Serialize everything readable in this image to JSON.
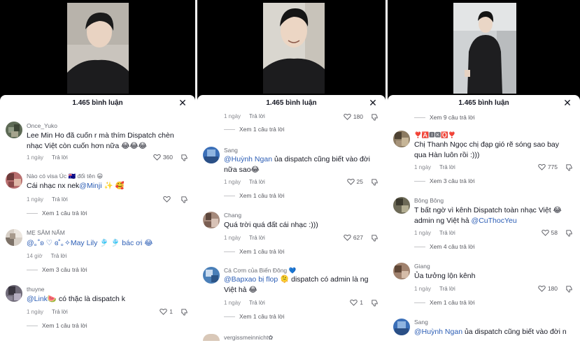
{
  "panels": [
    {
      "title": "1.465 bình luận",
      "top_replies": null,
      "comments": [
        {
          "user": "Once_Yuko",
          "text": "Lee Min Ho đã cuốn r mà thím Dispatch chèn nhạc Việt còn cuốn hơn nữa 😂😂😂",
          "time": "1 ngày",
          "reply": "Trả lời",
          "likes": "360",
          "replies": null
        },
        {
          "user": "Nào có visa Úc 🇦🇺 đổi tên 😁",
          "text": "Cái nhạc nx nek@Minji ✨ 🥰",
          "time": "1 ngày",
          "reply": "Trả lời",
          "likes": "",
          "replies": "Xem 1 câu trả lời"
        },
        {
          "user": "MẸ SÂM NẤM",
          "text": "@｡˚ʚ ♡ ɞ˚｡✧May Lily 🎐 🎐 bác ơi 😂",
          "time": "14 giờ",
          "reply": "Trả lời",
          "likes": "",
          "replies": "Xem 3 câu trả lời"
        },
        {
          "user": "thuyne",
          "text": "@Link🍉 có thặc là dispatch k",
          "time": "1 ngày",
          "reply": "Trả lời",
          "likes": "1",
          "replies": "Xem 1 câu trả lời"
        }
      ]
    },
    {
      "title": "1.465 bình luận",
      "top_meta": {
        "time": "1 ngày",
        "reply": "Trả lời",
        "likes": "180",
        "replies": "Xem 1 câu trả lời"
      },
      "comments": [
        {
          "user": "Sang",
          "text": "@Huỳnh Ngan ủa dispatch cũng biết vào đời nữa sao😂",
          "time": "1 ngày",
          "reply": "Trả lời",
          "likes": "25",
          "replies": "Xem 1 câu trả lời"
        },
        {
          "user": "Chang",
          "text": "Quá trời quá đất cái nhạc :)))",
          "time": "1 ngày",
          "reply": "Trả lời",
          "likes": "627",
          "replies": "Xem 1 câu trả lời"
        },
        {
          "user": "Cá Cơm của Biển Đông 💙",
          "text": "@Bapxao bị flop 🫠 dispatch có admin là ng Việt hả 😂",
          "time": "1 ngày",
          "reply": "Trả lời",
          "likes": "1",
          "replies": "Xem 1 câu trả lời"
        },
        {
          "user": "vergissmeinnicht✿",
          "text": "",
          "time": "",
          "reply": "",
          "likes": "",
          "replies": null
        }
      ]
    },
    {
      "title": "1.465 bình luận",
      "top_replies": "Xem 9 câu trả lời",
      "comments": [
        {
          "user": "❣️🅰️🅸🅺🅾️❣️",
          "text": "Chị Thanh Ngọc chị đạp gió rẽ sóng sao bay qua Hàn luôn rồi :)))",
          "time": "1 ngày",
          "reply": "Trả lời",
          "likes": "775",
          "replies": "Xem 3 câu trả lời"
        },
        {
          "user": "Bông Bông",
          "text": "T bất ngờ vì kênh Dispatch toàn nhạc Việt 😂 admin ng Việt hả @CuThocYeu",
          "time": "1 ngày",
          "reply": "Trả lời",
          "likes": "58",
          "replies": "Xem 4 câu trả lời"
        },
        {
          "user": "Giang",
          "text": "Ủa tưởng lộn kênh",
          "time": "1 ngày",
          "reply": "Trả lời",
          "likes": "180",
          "replies": "Xem 1 câu trả lời"
        },
        {
          "user": "Sang",
          "text": "@Huỳnh Ngan ủa dispatch cũng biết vào đời nữa",
          "time": "",
          "reply": "",
          "likes": "",
          "replies": null
        }
      ]
    }
  ],
  "colors": {
    "mention": "#2b5db5",
    "meta": "#8a8b91",
    "sheet_bg": "#ffffff",
    "video_bg": "#000000"
  },
  "icons": [
    "close-icon",
    "heart-outline-icon",
    "dislike-icon"
  ]
}
